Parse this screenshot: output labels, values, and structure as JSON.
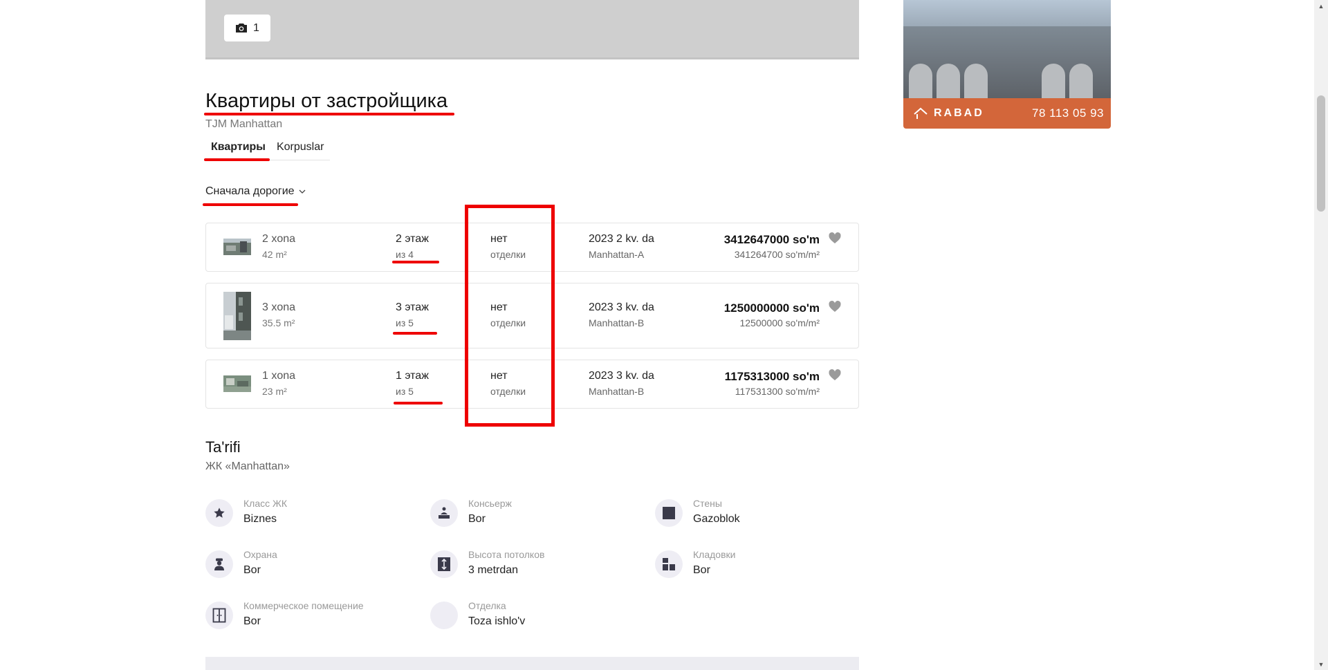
{
  "photo": {
    "count": "1"
  },
  "ad": {
    "brand": "RABAD",
    "phone": "78 113 05 93"
  },
  "section": {
    "title": "Квартиры от застройщика",
    "subtitle": "TJM Manhattan",
    "tabs": [
      {
        "label": "Квартиры",
        "active": true
      },
      {
        "label": "Korpuslar",
        "active": false
      }
    ],
    "sort_label": "Сначала дорогие"
  },
  "listings": [
    {
      "rooms": "2 xona",
      "area": "42 m²",
      "floor": "2 этаж",
      "floors_total": "из 4",
      "finish_1": "нет",
      "finish_2": "отделки",
      "completion": "2023 2 kv. da",
      "building": "Manhattan-A",
      "price": "3412647000 so'm",
      "price_per_m2": "341264700 so'm/m²"
    },
    {
      "rooms": "3 xona",
      "area": "35.5 m²",
      "floor": "3 этаж",
      "floors_total": "из 5",
      "finish_1": "нет",
      "finish_2": "отделки",
      "completion": "2023 3 kv. da",
      "building": "Manhattan-B",
      "price": "1250000000 so'm",
      "price_per_m2": "12500000 so'm/m²"
    },
    {
      "rooms": "1 xona",
      "area": "23 m²",
      "floor": "1 этаж",
      "floors_total": "из 5",
      "finish_1": "нет",
      "finish_2": "отделки",
      "completion": "2023 3 kv. da",
      "building": "Manhattan-B",
      "price": "1175313000 so'm",
      "price_per_m2": "117531300 so'm/m²"
    }
  ],
  "about": {
    "title": "Ta'rifi",
    "subtitle": "ЖК «Manhattan»",
    "features": [
      {
        "label": "Класс ЖК",
        "value": "Biznes",
        "icon": "star-icon"
      },
      {
        "label": "Консьерж",
        "value": "Bor",
        "icon": "concierge-icon"
      },
      {
        "label": "Стены",
        "value": "Gazoblok",
        "icon": "wall-icon"
      },
      {
        "label": "Охрана",
        "value": "Bor",
        "icon": "guard-icon"
      },
      {
        "label": "Высота потолков",
        "value": "3 metrdan",
        "icon": "ceiling-height-icon"
      },
      {
        "label": "Кладовки",
        "value": "Bor",
        "icon": "storage-icon"
      },
      {
        "label": "Коммерческое помещение",
        "value": "Bor",
        "icon": "commercial-space-icon"
      },
      {
        "label": "Отделка",
        "value": "Toza ishlo'v",
        "icon": "finishing-icon"
      }
    ]
  },
  "colors": {
    "accent_ad": "#d3663a",
    "annotation": "#e00000",
    "icon_bg": "#eeedf4"
  }
}
